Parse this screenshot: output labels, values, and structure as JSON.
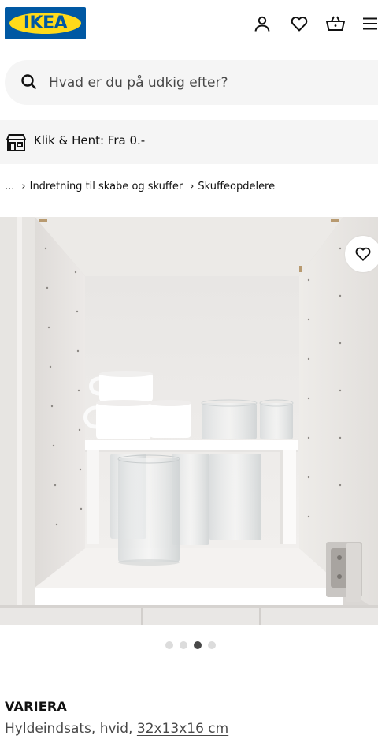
{
  "header": {
    "logo_text": "IKEA",
    "icons": [
      "account-icon",
      "heart-icon",
      "basket-icon",
      "menu-icon"
    ]
  },
  "search": {
    "placeholder": "Hvad er du på udkig efter?"
  },
  "click_collect": {
    "label": "Klik & Hent: Fra 0.-"
  },
  "breadcrumb": {
    "ellipsis": "...",
    "items": [
      "Indretning til skabe og skuffer",
      "Skuffeopdelere"
    ]
  },
  "carousel": {
    "count": 4,
    "active_index": 2
  },
  "product": {
    "name": "VARIERA",
    "description": "Hyldeindsats, hvid, ",
    "dimensions": "32x13x16 cm"
  },
  "colors": {
    "ikea_blue": "#0058a3",
    "ikea_yellow": "#ffda1a",
    "surface_grey": "#f5f5f5",
    "text_dark": "#111111",
    "text_muted": "#484848"
  }
}
